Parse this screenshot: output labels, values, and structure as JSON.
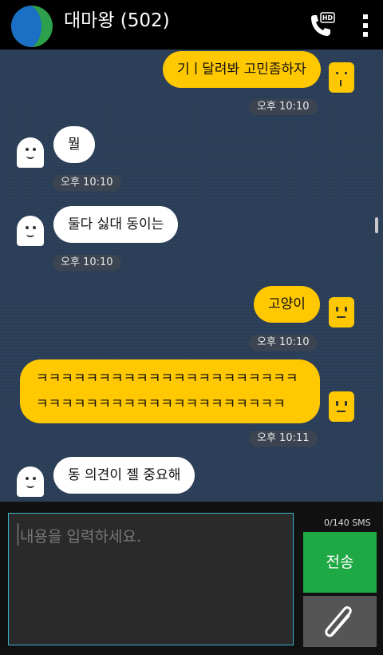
{
  "header": {
    "title": "대마왕 (502)"
  },
  "messages": [
    {
      "side": "me",
      "text": "기ㅣ달려봐 고민좀하자"
    },
    {
      "text": "오후 10:10"
    },
    {
      "side": "them",
      "text": "뭘"
    },
    {
      "text": "오후 10:10"
    },
    {
      "side": "them",
      "text": "둘다 싫대 동이는"
    },
    {
      "text": "오후 10:10"
    },
    {
      "side": "me",
      "text": "고양이"
    },
    {
      "text": "오후 10:10"
    },
    {
      "side": "me",
      "text": "ㅋㅋㅋㅋㅋㅋㅋㅋㅋㅋㅋㅋㅋㅋㅋㅋㅋㅋㅋㅋㅋㅋㅋㅋㅋㅋㅋㅋㅋㅋㅋㅋㅋㅋㅋㅋㅋㅋㅋㅋㅋ"
    },
    {
      "text": "오후 10:11"
    },
    {
      "side": "them",
      "text": "동 의견이 젤 중요해"
    }
  ],
  "composer": {
    "placeholder": "내용을 입력하세요.",
    "counter": "0/140 SMS",
    "send_label": "전송"
  },
  "colors": {
    "my_bubble": "#ffc800",
    "their_bubble": "#ffffff",
    "send_button": "#1fa944",
    "chat_bg": "#2b3e57"
  },
  "icons": {
    "call": "hd-call-icon",
    "menu": "more-vert-icon",
    "attach": "paperclip-icon"
  }
}
